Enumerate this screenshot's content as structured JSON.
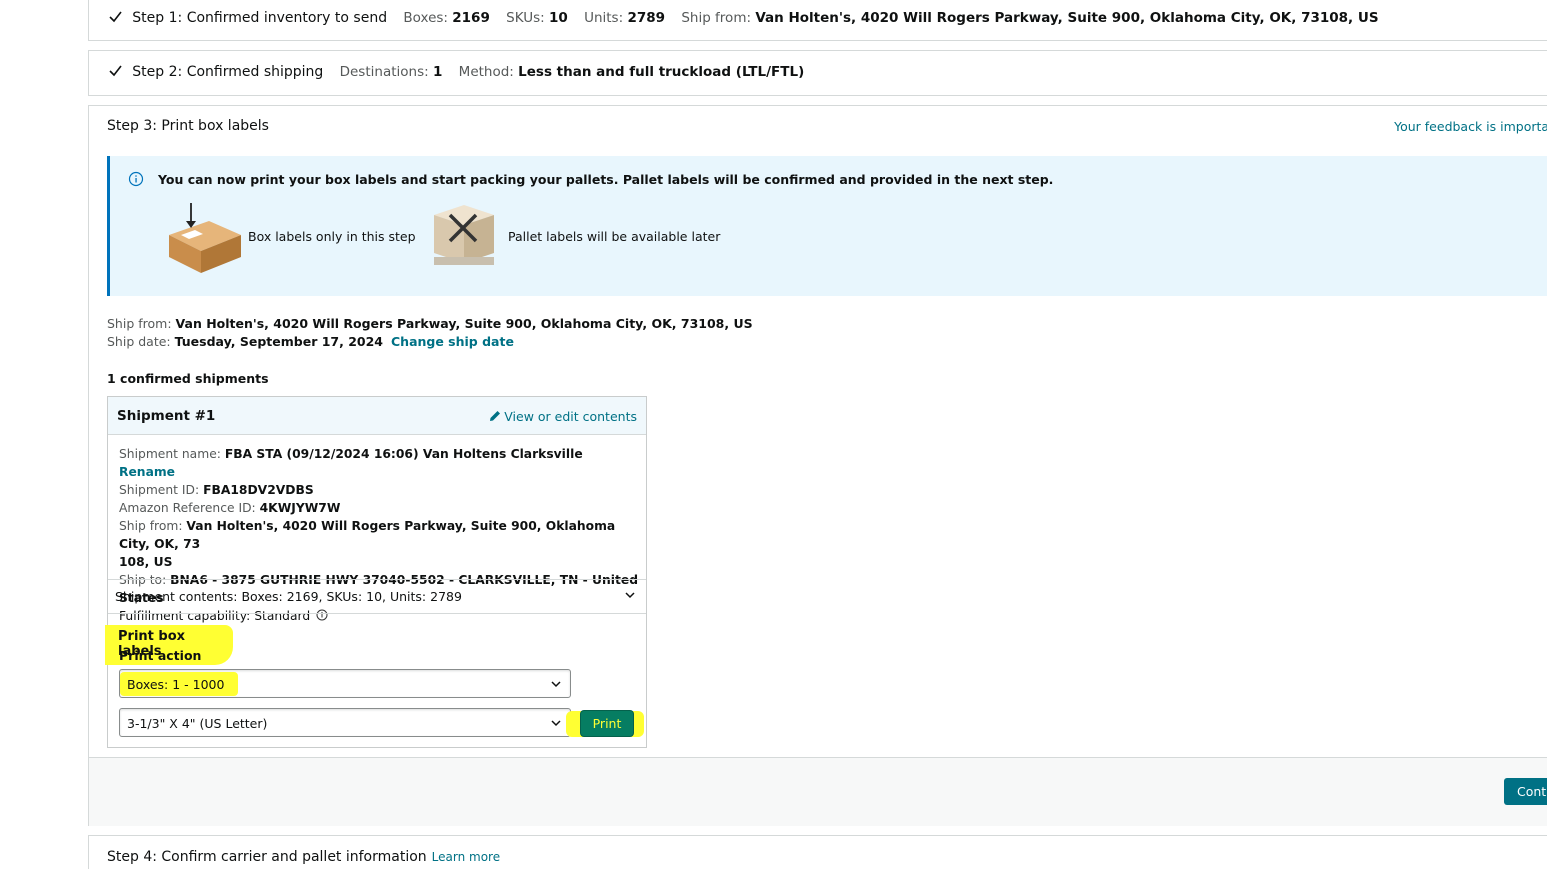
{
  "step1": {
    "title": "Step 1: Confirmed inventory to send",
    "boxes_label": "Boxes:",
    "boxes_value": "2169",
    "skus_label": "SKUs:",
    "skus_value": "10",
    "units_label": "Units:",
    "units_value": "2789",
    "shipfrom_label": "Ship from:",
    "shipfrom_value": "Van Holten's, 4020 Will Rogers Parkway, Suite 900,  Oklahoma City,  OK,  73108, US"
  },
  "step2": {
    "title": "Step 2: Confirmed shipping",
    "destinations_label": "Destinations:",
    "destinations_value": "1",
    "method_label": "Method:",
    "method_value": "Less than and full truckload (LTL/FTL)"
  },
  "step3": {
    "title": "Step 3: Print box labels",
    "feedback_link": "Your feedback is importan",
    "info": {
      "message": "You can now print your box labels and start packing your pallets. Pallet labels will be confirmed and provided in the next step.",
      "box_caption": "Box labels only in this step",
      "pallet_caption": "Pallet labels will be available later"
    },
    "ship_from_label": "Ship from:",
    "ship_from_value": "Van Holten's, 4020 Will Rogers Parkway, Suite 900,  Oklahoma City,  OK,  73108, US",
    "ship_date_label": "Ship date:",
    "ship_date_value": "Tuesday, September 17, 2024",
    "change_ship_date": "Change ship date",
    "confirmed_count": "1 confirmed shipments",
    "shipment": {
      "title": "Shipment #1",
      "edit_link": "View or edit contents",
      "name_label": "Shipment name:",
      "name_value": "FBA STA (09/12/2024 16:06) Van Holtens Clarksville",
      "rename": "Rename",
      "id_label": "Shipment ID:",
      "id_value": "FBA18DV2VDBS",
      "ref_label": "Amazon Reference ID:",
      "ref_value": "4KWJYW7W",
      "from_label": "Ship from:",
      "from_value_line1": "Van Holten's, 4020 Will Rogers Parkway, Suite 900,  Oklahoma City,  OK,  73",
      "from_value_line2": "108, US",
      "to_label": "Ship to:",
      "to_value": "BNA6  -  3875 GUTHRIE HWY  37040-5502  -  CLARKSVILLE,  TN  -  United States",
      "capability": "Fulfillment capability: Standard",
      "contents": "Shipment contents: Boxes: 2169, SKUs: 10, Units: 2789",
      "print_heading": "Print box labels",
      "print_action": "Print action",
      "boxes_select": "Boxes: 1 - 1000",
      "size_select": "3-1/3\" X 4\" (US Letter)",
      "print_button": "Print"
    },
    "continue_button": "Conti"
  },
  "step4": {
    "title": "Step 4: Confirm carrier and pallet information",
    "learn_more": "Learn more"
  },
  "colors": {
    "link": "#007185",
    "highlight": "#ffff33",
    "print_button": "#067d62",
    "info_bg": "#e8f6fd"
  }
}
